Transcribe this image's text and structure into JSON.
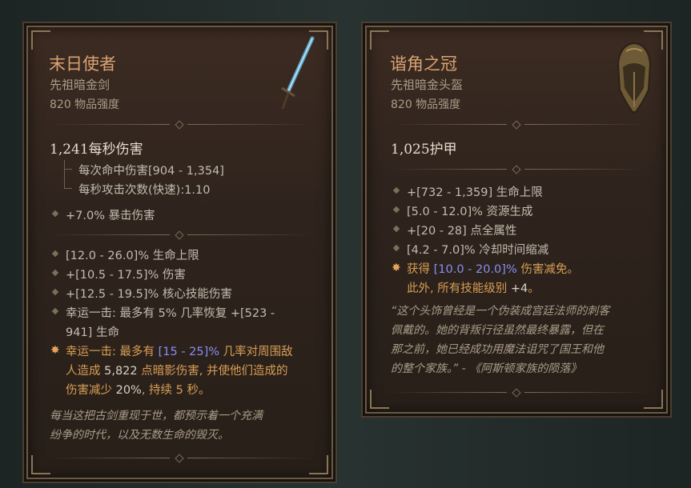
{
  "card_weapon": {
    "name": "末日使者",
    "type": "先祖暗金剑",
    "power": "820 物品强度",
    "main_stat": "1,241每秒伤害",
    "sub_stats": [
      "每次命中伤害[904 - 1,354]",
      "每秒攻击次数(快速):1.10"
    ],
    "implicit": "+7.0% 暴击伤害",
    "affixes": [
      "[12.0 - 26.0]% 生命上限",
      "+[10.5 - 17.5]% 伤害",
      "+[12.5 - 19.5]% 核心技能伤害",
      "幸运一击: 最多有 5% 几率恢复 +[523 -",
      "941] 生命"
    ],
    "unique": {
      "l1a": "幸运一击: 最多有 ",
      "l1b": "[15 - 25]%",
      "l1c": " 几率对周围敌",
      "l2a": "人造成 ",
      "l2b": "5,822",
      "l2c": " 点暗影伤害, 并使他们造成的",
      "l3a": "伤害减少 ",
      "l3b": "20%",
      "l3c": ", 持续 5 秒。"
    },
    "flavor_1": "每当这把古剑重现于世，都预示着一个充满",
    "flavor_2": "纷争的时代，以及无数生命的毁灭。",
    "icon": "sword-icon"
  },
  "card_helm": {
    "name": "谐角之冠",
    "type": "先祖暗金头盔",
    "power": "820 物品强度",
    "main_stat": "1,025护甲",
    "affixes": [
      "+[732 - 1,359] 生命上限",
      "[5.0 - 12.0]% 资源生成",
      "+[20 - 28] 点全属性",
      "[4.2 - 7.0]% 冷却时间缩减"
    ],
    "unique": {
      "l1a": "获得 ",
      "l1b": "[10.0 - 20.0]%",
      "l1c": " 伤害减免。",
      "l2a": "此外, 所有技能级别 ",
      "l2b": "+4",
      "l2c": "。"
    },
    "flavor_1": "“这个头饰曾经是一个伪装成宫廷法师的刺客",
    "flavor_2": "佩戴的。她的背叛行径虽然最终暴露，但在",
    "flavor_3": "那之前，她已经成功用魔法诅咒了国王和他",
    "flavor_4": "的整个家族。” - 《阿斯顿家族的陨落》",
    "icon": "helmet-icon"
  },
  "colors": {
    "title": "#d9a272",
    "unique_text": "#d89e55",
    "range_highlight": "#8c8cf5",
    "background": "#212a29"
  }
}
